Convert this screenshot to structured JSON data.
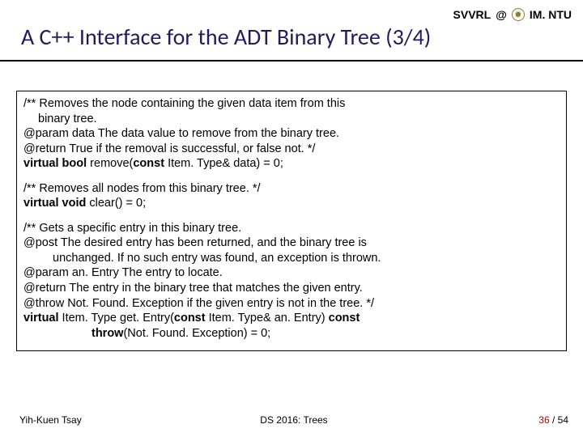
{
  "header": {
    "org_left": "SVVRL",
    "at": "@",
    "org_right": "IM. NTU"
  },
  "title": "A C++ Interface for the ADT Binary Tree (3/4)",
  "code": {
    "b1l1": "/** Removes the node containing the given data item from this",
    "b1l2": "binary tree.",
    "b1l3": "@param data  The data value to remove from the binary tree.",
    "b1l4": "@return  True if the removal is successful, or false not. */",
    "b1sig_a": "virtual bool ",
    "b1sig_b": "remove(",
    "b1sig_c": "const ",
    "b1sig_d": "Item. Type& data) = 0;",
    "b2l1": "/** Removes all nodes from this binary tree. */",
    "b2sig_a": "virtual void ",
    "b2sig_b": "clear() = 0;",
    "b3l1": "/** Gets a specific entry in this binary tree.",
    "b3l2": "@post  The desired entry has been returned, and the binary tree is",
    "b3l3": "unchanged. If no such entry was found, an exception is thrown.",
    "b3l4": "@param an. Entry  The entry to locate.",
    "b3l5": "@return  The entry in the binary tree that matches the given entry.",
    "b3l6": "@throw  Not. Found. Exception if the given entry is not in the tree. */",
    "b3sig_a": "virtual ",
    "b3sig_b": "Item. Type get. Entry(",
    "b3sig_c": "const ",
    "b3sig_d": "Item. Type& an. Entry) ",
    "b3sig_e": "const",
    "b3sig2_a": "throw",
    "b3sig2_b": "(Not. Found. Exception) = 0;"
  },
  "footer": {
    "author": "Yih-Kuen Tsay",
    "course": "DS 2016: Trees",
    "page_cur": "36 ",
    "page_sep": "/ 54"
  }
}
